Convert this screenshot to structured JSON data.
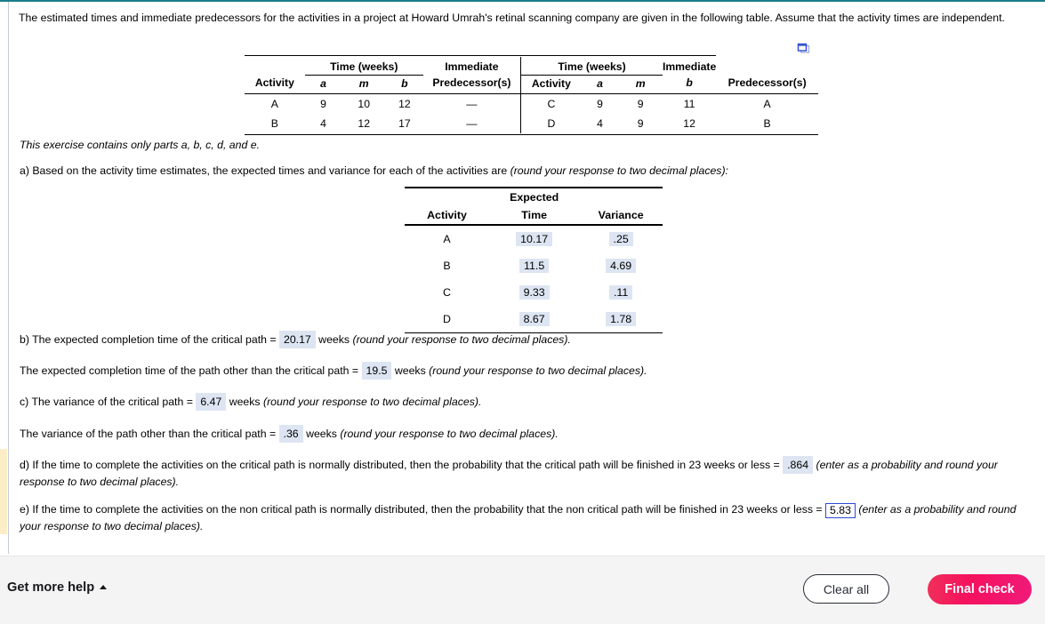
{
  "problem": {
    "intro": "The estimated times and immediate predecessors for the activities in a project at Howard Umrah's retinal scanning company are given in the following table. Assume that the activity times are independent.",
    "scope_note": "This exercise contains only parts a, b, c, d, and e."
  },
  "popout": {
    "icon": "popout-window-icon"
  },
  "table1": {
    "left": {
      "group_header": "Time (weeks)",
      "pred_header_line1": "Immediate",
      "pred_header_line2": "Predecessor(s)",
      "activity_header": "Activity",
      "col_a": "a",
      "col_m": "m",
      "col_b": "b",
      "rows": [
        {
          "activity": "A",
          "a": "9",
          "m": "10",
          "b": "12",
          "pred": "—"
        },
        {
          "activity": "B",
          "a": "4",
          "m": "12",
          "b": "17",
          "pred": "—"
        }
      ]
    },
    "right": {
      "group_header": "Time (weeks)",
      "pred_header_line1": "Immediate",
      "pred_header_line2": "Predecessor(s)",
      "activity_header": "Activity",
      "col_a": "a",
      "col_m": "m",
      "col_b": "b",
      "rows": [
        {
          "activity": "C",
          "a": "9",
          "m": "9",
          "b": "11",
          "pred": "A"
        },
        {
          "activity": "D",
          "a": "4",
          "m": "9",
          "b": "12",
          "pred": "B"
        }
      ]
    }
  },
  "part_a": {
    "prompt_plain": "a) Based on the activity time estimates, the expected times and variance for each of the activities are ",
    "prompt_italic": "(round your response to two decimal places):",
    "table": {
      "header_activity": "Activity",
      "header_expected_line1": "Expected",
      "header_expected_line2": "Time",
      "header_variance": "Variance",
      "rows": [
        {
          "activity": "A",
          "expected_time": "10.17",
          "variance": ".25"
        },
        {
          "activity": "B",
          "expected_time": "11.5",
          "variance": "4.69"
        },
        {
          "activity": "C",
          "expected_time": "9.33",
          "variance": ".11"
        },
        {
          "activity": "D",
          "expected_time": "8.67",
          "variance": "1.78"
        }
      ]
    }
  },
  "part_b": {
    "line1_pre": "b) The expected completion time of the critical path = ",
    "line1_value": "20.17",
    "line1_unit": " weeks ",
    "line1_italic": "(round your response to two decimal places).",
    "line2_pre": "The expected completion time of the path other than the critical path = ",
    "line2_value": "19.5",
    "line2_unit": " weeks ",
    "line2_italic": "(round your response to two decimal places)."
  },
  "part_c": {
    "line1_pre": "c) The variance of the critical path = ",
    "line1_value": "6.47",
    "line1_unit": " weeks ",
    "line1_italic": "(round your response to two decimal places).",
    "line2_pre": "The variance of the path other than the critical path = ",
    "line2_value": ".36",
    "line2_unit": " weeks ",
    "line2_italic": "(round your response to two decimal places)."
  },
  "part_d": {
    "pre": "d) If the time to complete the activities on the critical path is normally distributed, then the probability that the critical path will be finished in 23 weeks or less = ",
    "value": ".864",
    "italic": "(enter as a probability and round your response to two decimal places)."
  },
  "part_e": {
    "pre": "e) If the time to complete the activities on the non critical path is normally distributed, then the probability that the non critical path will be finished in 23 weeks or less = ",
    "value": "5.83",
    "italic": "(enter as a probability and round your response to two decimal places)."
  },
  "footer": {
    "help_label": "Get more help",
    "clear_label": "Clear all",
    "final_label": "Final check"
  },
  "colors": {
    "top_rule": "#1a7d8c",
    "answer_fill": "#dde5f2",
    "active_input_border": "#2b49d6",
    "highlight_rail": "#fbeec6",
    "final_check_start": "#f0315a",
    "final_check_end": "#f01a7a"
  }
}
